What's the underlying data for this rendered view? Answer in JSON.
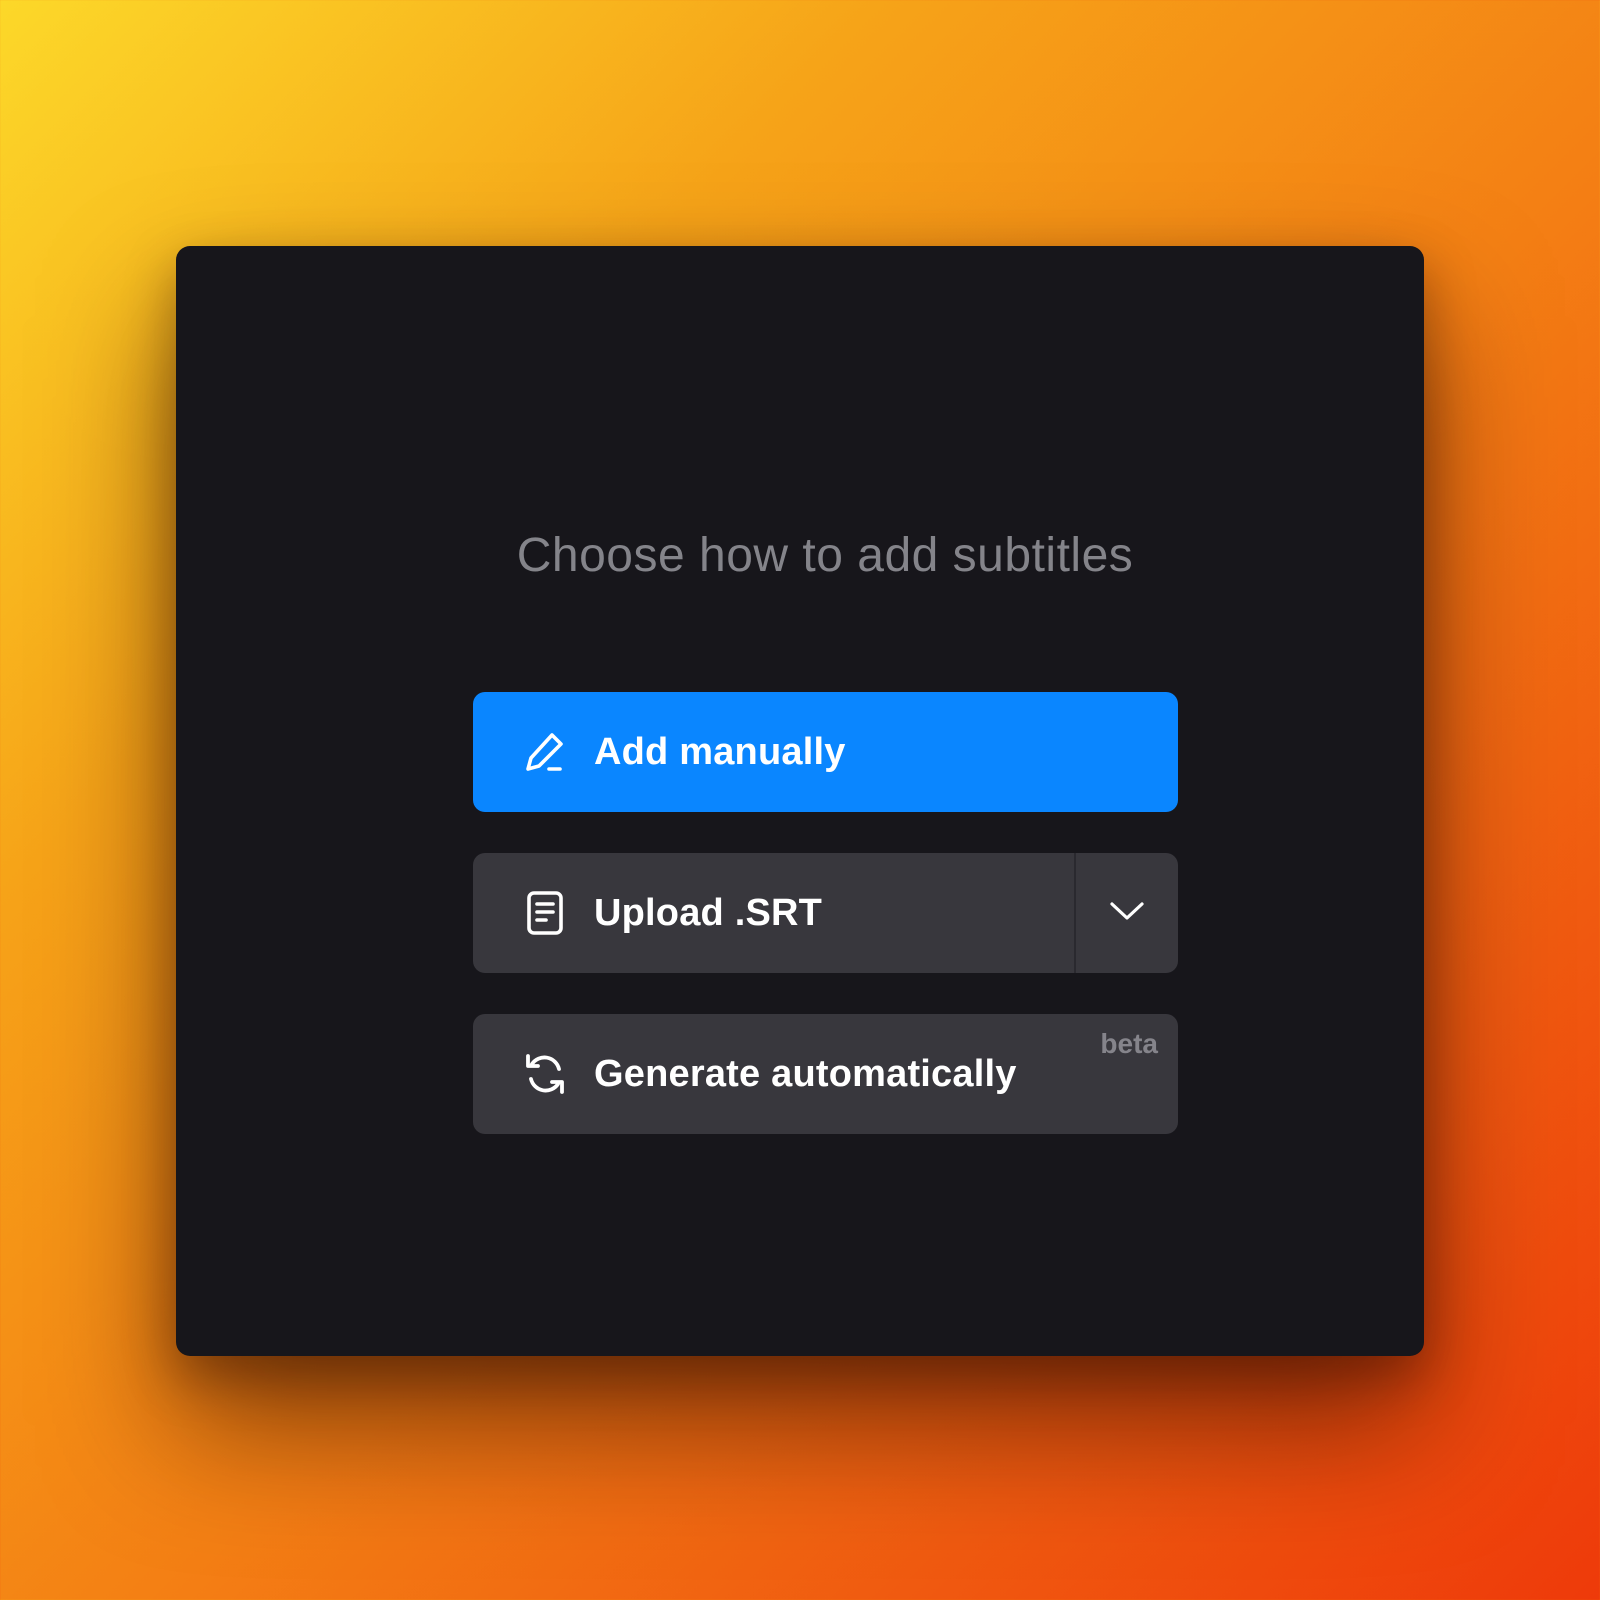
{
  "dialog": {
    "heading": "Choose how to add subtitles"
  },
  "options": {
    "add_manually": {
      "label": "Add manually",
      "icon": "pencil-icon",
      "color": "#0a86ff"
    },
    "upload_srt": {
      "label": "Upload .SRT",
      "icon": "document-icon",
      "dropdown_icon": "chevron-down-icon"
    },
    "generate_automatically": {
      "label": "Generate automatically",
      "icon": "refresh-icon",
      "badge": "beta"
    }
  },
  "colors": {
    "panel_background": "#17161b",
    "secondary_button": "#38373d",
    "heading_text": "#84848a",
    "badge_text": "#85848b"
  }
}
